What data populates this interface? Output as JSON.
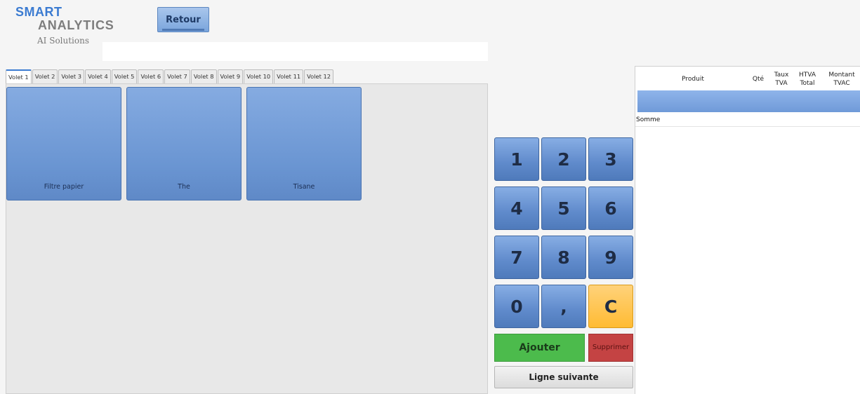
{
  "header": {
    "logo_line1": "SMART",
    "logo_line2": "ANALYTICS",
    "logo_line3": "AI Solutions",
    "back_button": "Retour",
    "search_value": ""
  },
  "tabs": [
    {
      "label": "Volet 1",
      "active": true
    },
    {
      "label": "Volet 2"
    },
    {
      "label": "Volet 3"
    },
    {
      "label": "Volet 4"
    },
    {
      "label": "Volet 5"
    },
    {
      "label": "Volet 6"
    },
    {
      "label": "Volet 7"
    },
    {
      "label": "Volet 8"
    },
    {
      "label": "Volet 9"
    },
    {
      "label": "Volet 10"
    },
    {
      "label": "Volet 11"
    },
    {
      "label": "Volet 12"
    }
  ],
  "products": [
    {
      "label": "Filtre papier"
    },
    {
      "label": "The"
    },
    {
      "label": "Tisane"
    }
  ],
  "keypad": {
    "keys": [
      "1",
      "2",
      "3",
      "4",
      "5",
      "6",
      "7",
      "8",
      "9",
      "0",
      ",",
      "C"
    ],
    "add_label": "Ajouter",
    "delete_label": "Supprimer",
    "next_line_label": "Ligne suivante"
  },
  "table": {
    "headers": {
      "produit": "Produit",
      "qte": "Qté",
      "taux_tva_1": "Taux",
      "taux_tva_2": "TVA",
      "htva_1": "HTVA",
      "htva_2": "Total",
      "montant_1": "Montant",
      "montant_2": "TVAC"
    },
    "sum_label": "Somme"
  },
  "colors": {
    "accent_blue": "#3b7bd1",
    "key_blue": "#6f9ad8",
    "clear_orange": "#ffbb33",
    "add_green": "#4cbb4c",
    "delete_red": "#c44343"
  }
}
